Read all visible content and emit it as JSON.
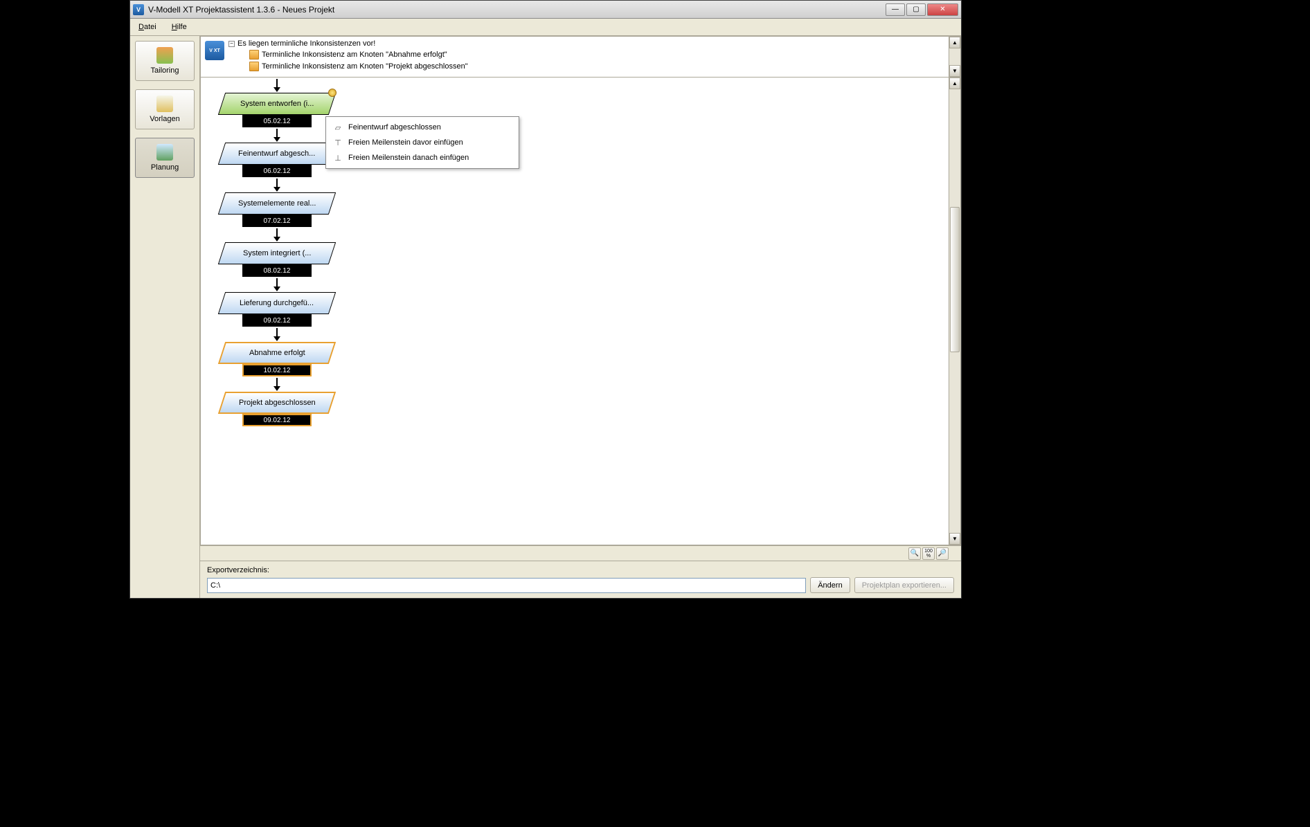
{
  "window": {
    "title": "V-Modell XT Projektassistent 1.3.6 - Neues Projekt"
  },
  "menu": {
    "file": "Datei",
    "help": "Hilfe"
  },
  "sidebar": {
    "tailoring": "Tailoring",
    "vorlagen": "Vorlagen",
    "planung": "Planung"
  },
  "info": {
    "root": "Es liegen terminliche Inkonsistenzen vor!",
    "child1": "Terminliche Inkonsistenz am Knoten \"Abnahme erfolgt\"",
    "child2": "Terminliche Inkonsistenz am Knoten \"Projekt abgeschlossen\""
  },
  "nodes": [
    {
      "label": "System entworfen (i...",
      "date": "05.02.12",
      "style": "green",
      "badge": true
    },
    {
      "label": "Feinentwurf abgesch...",
      "date": "06.02.12",
      "style": "blue"
    },
    {
      "label": "Systemelemente real...",
      "date": "07.02.12",
      "style": "blue"
    },
    {
      "label": "System integriert (...",
      "date": "08.02.12",
      "style": "blue"
    },
    {
      "label": "Lieferung durchgefü...",
      "date": "09.02.12",
      "style": "blue"
    },
    {
      "label": "Abnahme erfolgt",
      "date": "10.02.12",
      "style": "warn"
    },
    {
      "label": "Projekt abgeschlossen",
      "date": "09.02.12",
      "style": "warn"
    }
  ],
  "context": {
    "item1": "Feinentwurf abgeschlossen",
    "item2": "Freien Meilenstein davor einfügen",
    "item3": "Freien Meilenstein danach einfügen"
  },
  "zoom_label": "100 %",
  "export": {
    "label": "Exportverzeichnis:",
    "value": "C:\\",
    "change": "Ändern",
    "exportBtn": "Projektplan exportieren..."
  }
}
